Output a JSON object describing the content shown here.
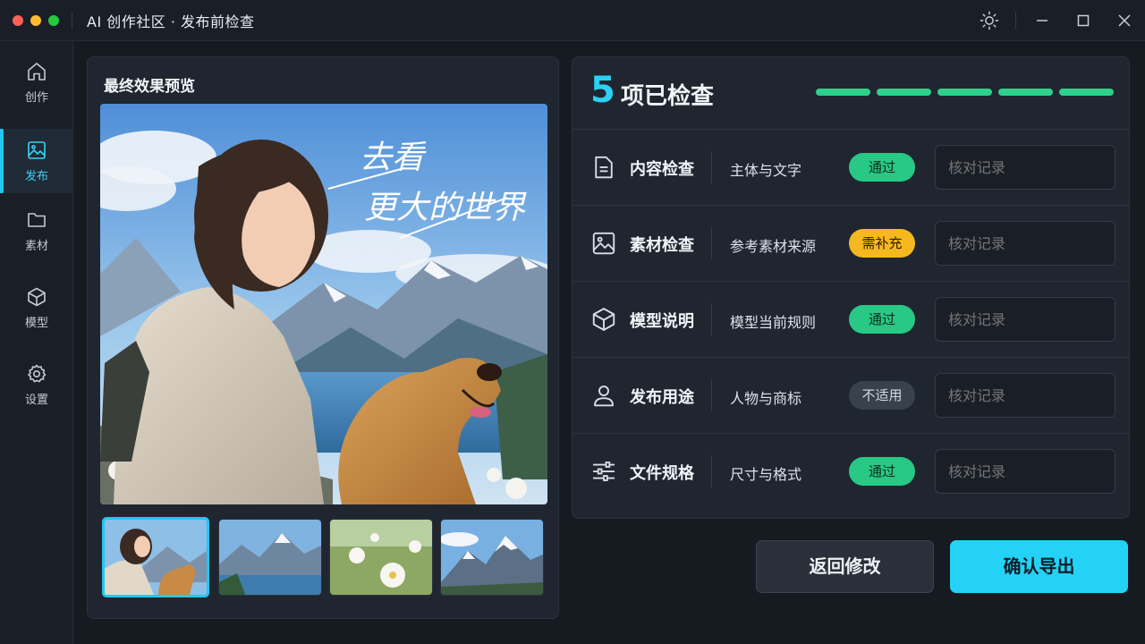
{
  "window": {
    "title": "AI 创作社区 · 发布前检查",
    "icons": [
      "sun-icon",
      "minimize-icon",
      "maximize-icon",
      "close-icon"
    ]
  },
  "sidebar": {
    "items": [
      {
        "label": "创作",
        "icon": "home-icon",
        "active": false
      },
      {
        "label": "发布",
        "icon": "image-icon",
        "active": true
      },
      {
        "label": "素材",
        "icon": "folder-icon",
        "active": false
      },
      {
        "label": "模型",
        "icon": "cube-icon",
        "active": false
      },
      {
        "label": "设置",
        "icon": "gear-icon",
        "active": false
      }
    ]
  },
  "preview": {
    "title": "最终效果预览",
    "overlay_text_line1": "去看",
    "overlay_text_line2": "更大的世界",
    "thumbnails": [
      "girl-and-dog",
      "lake-mountains",
      "white-flowers",
      "snow-peaks"
    ],
    "selected_thumbnail": 0
  },
  "checks": {
    "count": "5",
    "count_label": "项已检查",
    "progress_filled": 5,
    "progress_total": 5,
    "rows": [
      {
        "name": "内容检查",
        "desc": "主体与文字",
        "status": "通过",
        "status_type": "pass",
        "record_placeholder": "核对记录",
        "icon": "document-icon"
      },
      {
        "name": "素材检查",
        "desc": "参考素材来源",
        "status": "需补充",
        "status_type": "warn",
        "record_placeholder": "核对记录",
        "icon": "image-icon"
      },
      {
        "name": "模型说明",
        "desc": "模型当前规则",
        "status": "通过",
        "status_type": "pass",
        "record_placeholder": "核对记录",
        "icon": "cube-icon"
      },
      {
        "name": "发布用途",
        "desc": "人物与商标",
        "status": "不适用",
        "status_type": "na",
        "record_placeholder": "核对记录",
        "icon": "user-icon"
      },
      {
        "name": "文件规格",
        "desc": "尺寸与格式",
        "status": "通过",
        "status_type": "pass",
        "record_placeholder": "核对记录",
        "icon": "sliders-icon"
      }
    ]
  },
  "actions": {
    "back_label": "返回修改",
    "export_label": "确认导出"
  },
  "colors": {
    "accent": "#22c7f0",
    "pass": "#27c984",
    "warn": "#f6b81f",
    "background": "#161b22",
    "panel": "#202630"
  }
}
